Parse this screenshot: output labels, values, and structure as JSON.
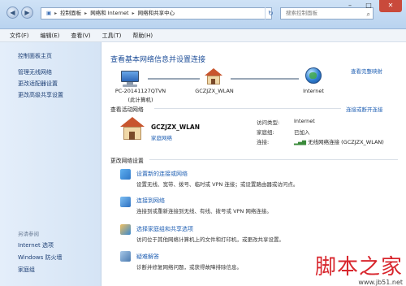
{
  "window": {
    "breadcrumb": [
      "控制面板",
      "网络和 Internet",
      "网络和共享中心"
    ],
    "search_placeholder": "搜索控制面板",
    "controls": [
      "–",
      "□",
      "✕"
    ]
  },
  "menu": [
    "文件(F)",
    "编辑(E)",
    "查看(V)",
    "工具(T)",
    "帮助(H)"
  ],
  "sidebar": {
    "home": "控制面板主页",
    "links": [
      "管理无线网络",
      "更改适配器设置",
      "更改高级共享设置"
    ],
    "see_also_title": "另请参阅",
    "see_also": [
      "Internet 选项",
      "Windows 防火墙",
      "家庭组"
    ]
  },
  "main": {
    "title": "查看基本网络信息并设置连接",
    "view_full_map": "查看完整映射",
    "nodes": [
      {
        "label": "PC-20141127QTVN",
        "sub": "(此计算机)"
      },
      {
        "label": "GCZJZX_WLAN",
        "sub": ""
      },
      {
        "label": "Internet",
        "sub": ""
      }
    ],
    "active_title": "查看活动网络",
    "connect_disconnect": "连接或断开连接",
    "active_network": {
      "name": "GCZJZX_WLAN",
      "type": "家庭网络",
      "access_type_label": "访问类型:",
      "access_type": "Internet",
      "homegroup_label": "家庭组:",
      "homegroup": "已加入",
      "connection_label": "连接:",
      "connection": "无线网络连接 (GCZJZX_WLAN)"
    },
    "change_title": "更改网络设置",
    "tasks": [
      {
        "title": "设置新的连接或网络",
        "desc": "设置无线、宽带、拨号、临时或 VPN 连接；或设置路由器或访问点。"
      },
      {
        "title": "连接到网络",
        "desc": "连接到或重新连接到无线、有线、拨号或 VPN 网络连接。"
      },
      {
        "title": "选择家庭组和共享选项",
        "desc": "访问位于其他网络计算机上的文件和打印机，或更改共享设置。"
      },
      {
        "title": "疑难解答",
        "desc": "诊断并修复网络问题，或获得故障排除信息。"
      }
    ]
  },
  "watermark": {
    "text": "脚本之家",
    "url": "www.jb51.net"
  },
  "colors": {
    "link": "#1f5fb3",
    "title": "#1f4f99",
    "sidebar_bg": "#dce8f6",
    "watermark": "#d8262d"
  }
}
